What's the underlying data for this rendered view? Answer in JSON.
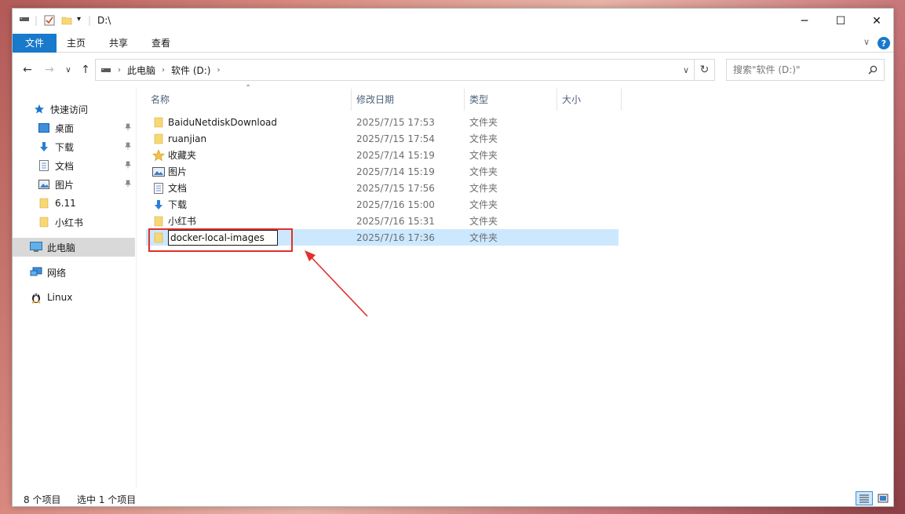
{
  "window": {
    "title": "D:\\",
    "minimize": "─",
    "maximize": "☐",
    "close": "✕"
  },
  "ribbon": {
    "tabs": [
      "文件",
      "主页",
      "共享",
      "查看"
    ],
    "expand": "∨",
    "help": "?"
  },
  "nav": {
    "back": "←",
    "forward": "→",
    "recent": "∨",
    "up": "↑",
    "breadcrumb": [
      "此电脑",
      "软件 (D:)"
    ],
    "sep": "›",
    "dropdown": "∨",
    "refresh": "↻",
    "search_placeholder": "搜索\"软件 (D:)\""
  },
  "sidebar": {
    "items": [
      {
        "label": "快速访问",
        "icon": "star-icon"
      },
      {
        "label": "桌面",
        "icon": "desktop-icon",
        "pinned": true
      },
      {
        "label": "下载",
        "icon": "download-icon",
        "pinned": true
      },
      {
        "label": "文档",
        "icon": "document-icon",
        "pinned": true
      },
      {
        "label": "图片",
        "icon": "picture-icon",
        "pinned": true
      },
      {
        "label": "6.11",
        "icon": "folder-icon"
      },
      {
        "label": "小红书",
        "icon": "folder-icon"
      },
      {
        "label": "此电脑",
        "icon": "computer-icon",
        "selected": true
      },
      {
        "label": "网络",
        "icon": "network-icon"
      },
      {
        "label": "Linux",
        "icon": "linux-icon"
      }
    ],
    "pin_glyph": "📌"
  },
  "columns": {
    "name": "名称",
    "date": "修改日期",
    "type": "类型",
    "size": "大小",
    "sort_glyph": "⌃"
  },
  "files": [
    {
      "name": "BaiduNetdiskDownload",
      "date": "2025/7/15 17:53",
      "type": "文件夹",
      "icon": "folder-icon"
    },
    {
      "name": "ruanjian",
      "date": "2025/7/15 17:54",
      "type": "文件夹",
      "icon": "folder-icon"
    },
    {
      "name": "收藏夹",
      "date": "2025/7/14 15:19",
      "type": "文件夹",
      "icon": "favorites-star-icon"
    },
    {
      "name": "图片",
      "date": "2025/7/14 15:19",
      "type": "文件夹",
      "icon": "picture-icon"
    },
    {
      "name": "文档",
      "date": "2025/7/15 17:56",
      "type": "文件夹",
      "icon": "document-icon"
    },
    {
      "name": "下载",
      "date": "2025/7/16 15:00",
      "type": "文件夹",
      "icon": "download-icon"
    },
    {
      "name": "小红书",
      "date": "2025/7/16 15:31",
      "type": "文件夹",
      "icon": "folder-icon"
    },
    {
      "name": "docker-local-images",
      "date": "2025/7/16 17:36",
      "type": "文件夹",
      "icon": "folder-icon",
      "renaming": true
    }
  ],
  "status": {
    "count": "8 个项目",
    "selected": "选中 1 个项目"
  },
  "colors": {
    "accent": "#1979ca",
    "selection": "#cce8ff",
    "annotation": "#e0302e"
  }
}
